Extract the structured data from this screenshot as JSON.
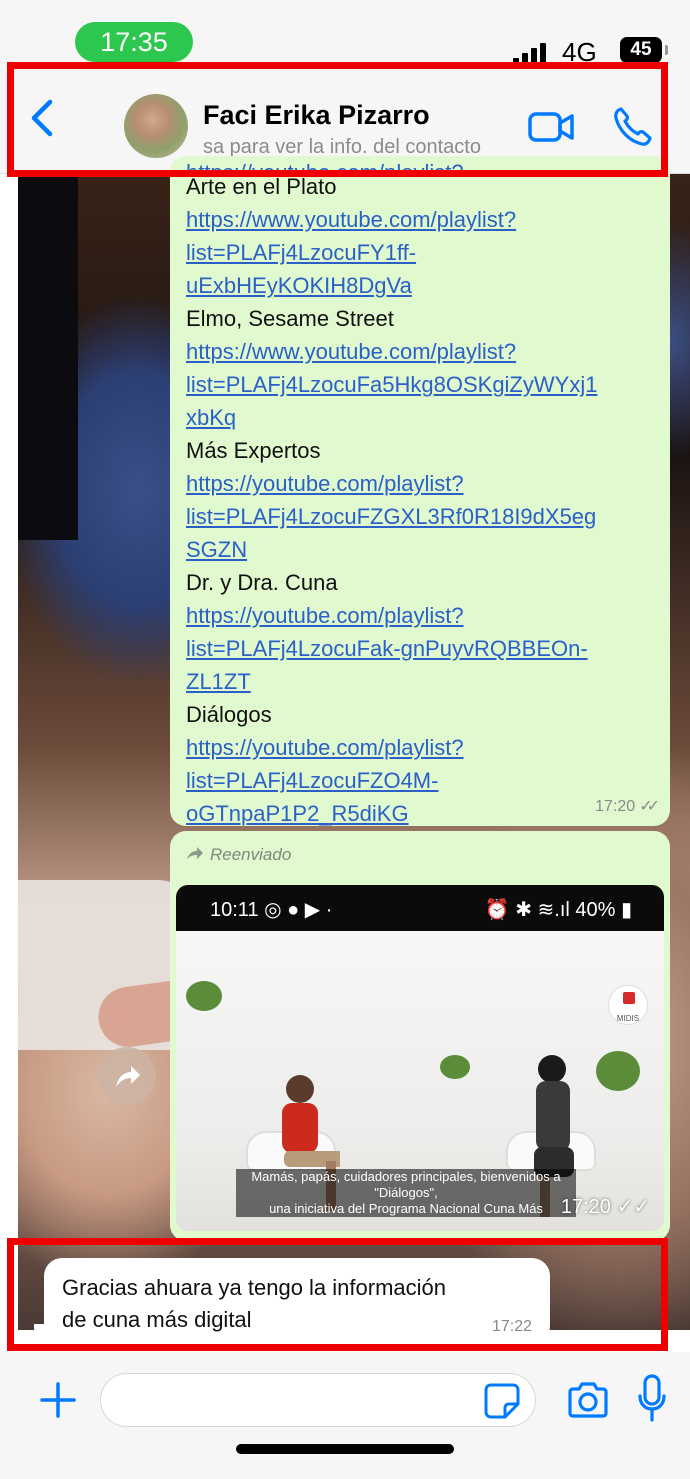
{
  "status_bar": {
    "time": "17:35",
    "network": "4G",
    "battery": "45"
  },
  "header": {
    "contact_name": "Faci Erika Pizarro",
    "contact_subtitle": "sa para ver la info. del contacto"
  },
  "messages": {
    "outgoing_links": {
      "partial_top_line": "https://youtube.com/playlist?",
      "lines": [
        {
          "text": "Arte en el Plato",
          "link": false
        },
        {
          "text": "https://www.youtube.com/playlist?",
          "link": true
        },
        {
          "text": "list=PLAFj4LzocuFY1ff-",
          "link": true
        },
        {
          "text": "uExbHEyKOKIH8DgVa",
          "link": true
        },
        {
          "text": "Elmo, Sesame Street",
          "link": false
        },
        {
          "text": "https://www.youtube.com/playlist?",
          "link": true
        },
        {
          "text": "list=PLAFj4LzocuFa5Hkg8OSKgiZyWYxj1",
          "link": true
        },
        {
          "text": "xbKq",
          "link": true
        },
        {
          "text": "Más Expertos",
          "link": false
        },
        {
          "text": "https://youtube.com/playlist?",
          "link": true
        },
        {
          "text": "list=PLAFj4LzocuFZGXL3Rf0R18I9dX5eg",
          "link": true
        },
        {
          "text": "SGZN",
          "link": true
        },
        {
          "text": "Dr. y Dra. Cuna",
          "link": false
        },
        {
          "text": "https://youtube.com/playlist?",
          "link": true
        },
        {
          "text": "list=PLAFj4LzocuFak-gnPuyvRQBBEOn-",
          "link": true
        },
        {
          "text": "ZL1ZT",
          "link": true
        },
        {
          "text": "Diálogos",
          "link": false
        },
        {
          "text": "https://youtube.com/playlist?",
          "link": true
        },
        {
          "text": "list=PLAFj4LzocuFZO4M-",
          "link": true
        },
        {
          "text": "oGTnpaP1P2_R5diKG",
          "link": true
        }
      ],
      "time": "17:20"
    },
    "forwarded_video": {
      "forwarded_label": "Reenviado",
      "thumb_status_time": "10:11",
      "thumb_status_right": "40%",
      "logo_text": "MIDIS",
      "subtitle_line1": "Mamás, papás, cuidadores principales, bienvenidos a \"Diálogos\",",
      "subtitle_line2": "una iniciativa del Programa Nacional Cuna Más",
      "time": "17:20"
    },
    "incoming": {
      "line1": "Gracias ahuara ya tengo la información",
      "line2": "de cuna más digital",
      "time": "17:22"
    }
  },
  "input": {
    "placeholder": "",
    "value": ""
  },
  "colors": {
    "accent": "#007aff",
    "outgoing_bubble": "#e0f9cf",
    "link": "#2a60c8",
    "annotation": "#ee0000"
  }
}
